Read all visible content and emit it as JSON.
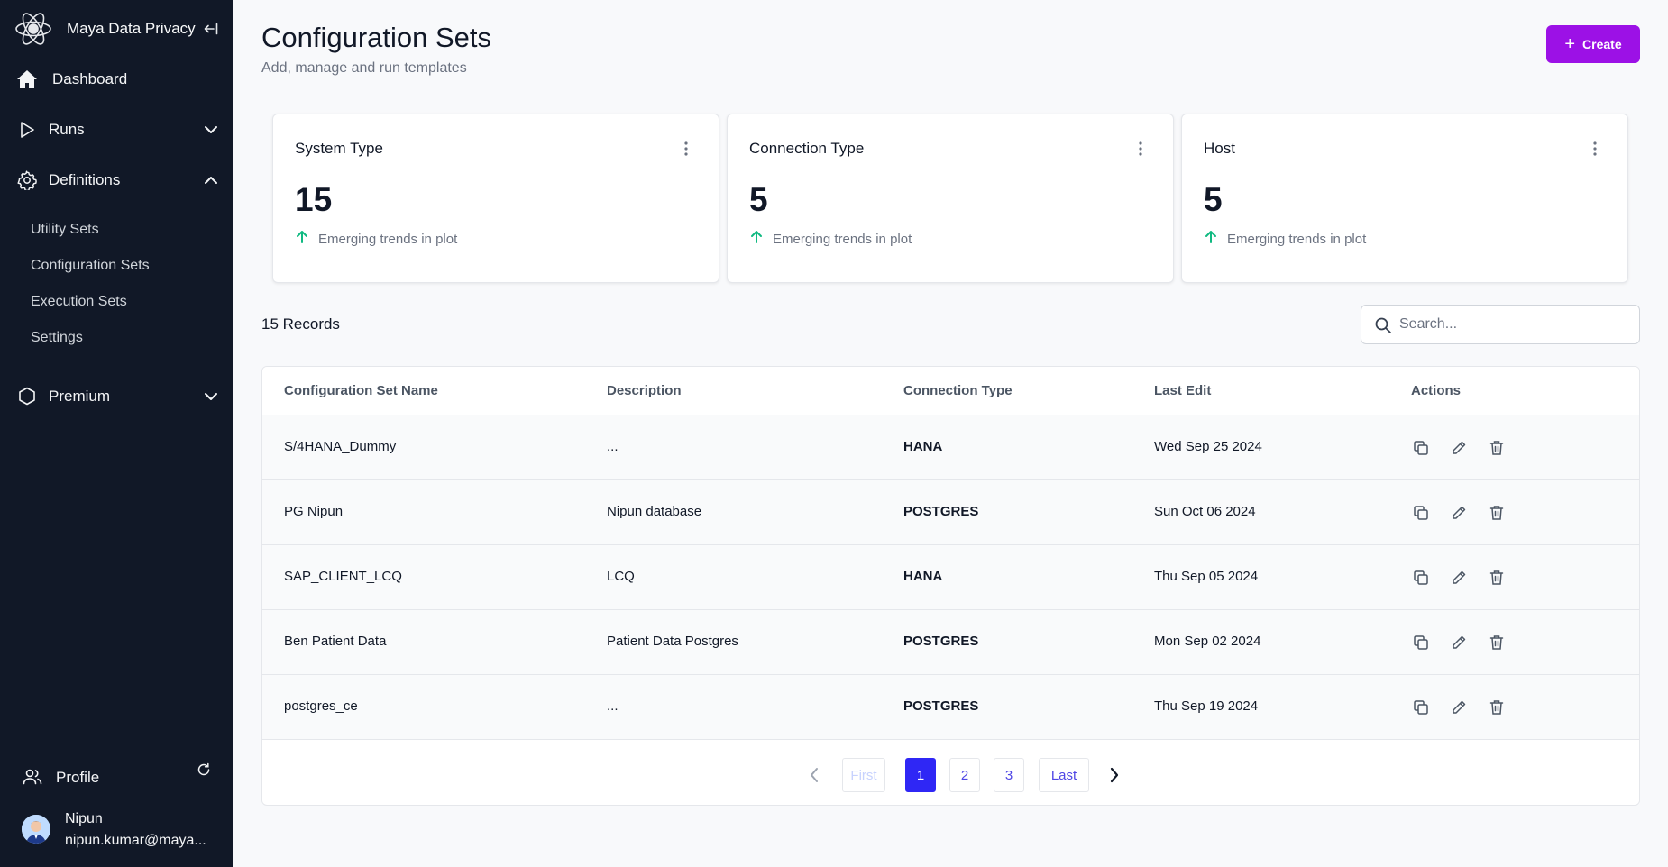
{
  "app": {
    "name": "Maya Data Privacy"
  },
  "sidebar": {
    "nav": [
      {
        "label": "Dashboard",
        "icon": "home-icon"
      },
      {
        "label": "Runs",
        "icon": "play-icon",
        "expanded": false
      },
      {
        "label": "Definitions",
        "icon": "gear-icon",
        "expanded": true
      },
      {
        "label": "Premium",
        "icon": "hexagon-icon",
        "expanded": false
      }
    ],
    "definitions_children": [
      "Utility Sets",
      "Configuration Sets",
      "Execution Sets",
      "Settings"
    ],
    "profile_label": "Profile",
    "user": {
      "name": "Nipun",
      "email": "nipun.kumar@maya..."
    }
  },
  "header": {
    "title": "Configuration Sets",
    "subtitle": "Add, manage and run templates",
    "create_label": "Create"
  },
  "stats": [
    {
      "title": "System Type",
      "value": "15",
      "trend": "Emerging trends in plot"
    },
    {
      "title": "Connection Type",
      "value": "5",
      "trend": "Emerging trends in plot"
    },
    {
      "title": "Host",
      "value": "5",
      "trend": "Emerging trends in plot"
    }
  ],
  "records": {
    "count_label": "15 Records",
    "search_placeholder": "Search..."
  },
  "table": {
    "columns": [
      "Configuration Set Name",
      "Description",
      "Connection Type",
      "Last Edit",
      "Actions"
    ],
    "rows": [
      {
        "name": "S/4HANA_Dummy",
        "description": "...",
        "connection_type": "HANA",
        "last_edit": "Wed Sep 25 2024"
      },
      {
        "name": "PG Nipun",
        "description": "Nipun database",
        "connection_type": "POSTGRES",
        "last_edit": "Sun Oct 06 2024"
      },
      {
        "name": "SAP_CLIENT_LCQ",
        "description": "LCQ",
        "connection_type": "HANA",
        "last_edit": "Thu Sep 05 2024"
      },
      {
        "name": "Ben Patient Data",
        "description": "Patient Data Postgres",
        "connection_type": "POSTGRES",
        "last_edit": "Mon Sep 02 2024"
      },
      {
        "name": "postgres_ce",
        "description": "...",
        "connection_type": "POSTGRES",
        "last_edit": "Thu Sep 19 2024"
      }
    ]
  },
  "pagination": {
    "first": "First",
    "pages": [
      "1",
      "2",
      "3"
    ],
    "current": "1",
    "last": "Last"
  },
  "colors": {
    "sidebar_bg": "#111827",
    "accent": "#9c11e6",
    "active_page": "#2f27f5",
    "trend_up": "#10b981"
  }
}
